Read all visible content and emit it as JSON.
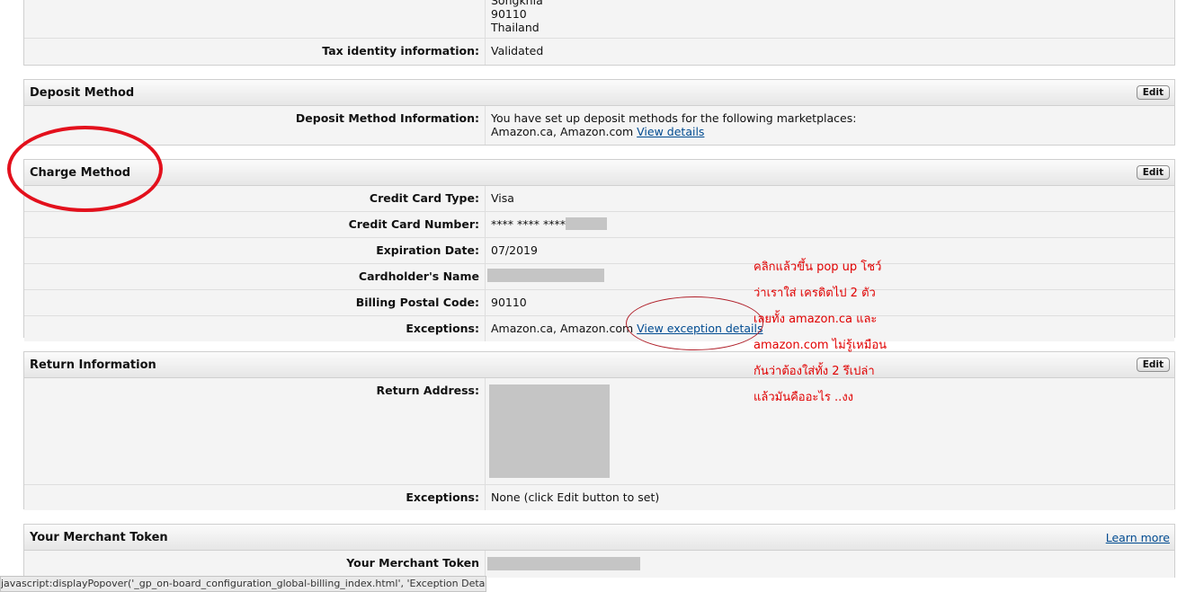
{
  "address": {
    "lines": [
      "Songkhla",
      "90110",
      "Thailand"
    ],
    "tax_label": "Tax identity information:",
    "tax_value": "Validated"
  },
  "deposit": {
    "title": "Deposit Method",
    "edit_label": "Edit",
    "info_label": "Deposit Method Information:",
    "info_text_1": "You have set up deposit methods for the following marketplaces:",
    "info_text_2": "Amazon.ca, Amazon.com",
    "view_details": "View details"
  },
  "charge": {
    "title": "Charge Method",
    "edit_label": "Edit",
    "card_type_label": "Credit Card Type:",
    "card_type": "Visa",
    "card_number_label": "Credit Card Number:",
    "card_number_masked": "**** **** ****",
    "expiration_label": "Expiration Date:",
    "expiration": "07/2019",
    "holder_label": "Cardholder's Name",
    "postal_label": "Billing Postal Code:",
    "postal": "90110",
    "exceptions_label": "Exceptions:",
    "exceptions_text": "Amazon.ca, Amazon.com",
    "view_exception": "View exception details"
  },
  "return_info": {
    "title": "Return Information",
    "edit_label": "Edit",
    "address_label": "Return Address:",
    "exceptions_label": "Exceptions:",
    "exceptions_text": "None (click Edit button to set)"
  },
  "merchant": {
    "title": "Your Merchant Token",
    "learn_more": "Learn more",
    "token_label": "Your Merchant Token"
  },
  "annotation": {
    "lines": [
      "คลิกแล้วขึ้น   pop up โชว์",
      "ว่าเราใส่   เครดิตไป   2 ตัว",
      "เลยทั้ง   amazon.ca และ",
      "amazon.com ไม่รู้เหมือน",
      "กันว่าต้องใส่ทั้ง   2 รึเปล่า",
      "แล้วมันคืออะไร   ..งง"
    ],
    "color": "#e00000"
  },
  "status_bar": {
    "text": "javascript:displayPopover('_gp_on-board_configuration_global-billing_index.html', 'Exception Details')"
  }
}
